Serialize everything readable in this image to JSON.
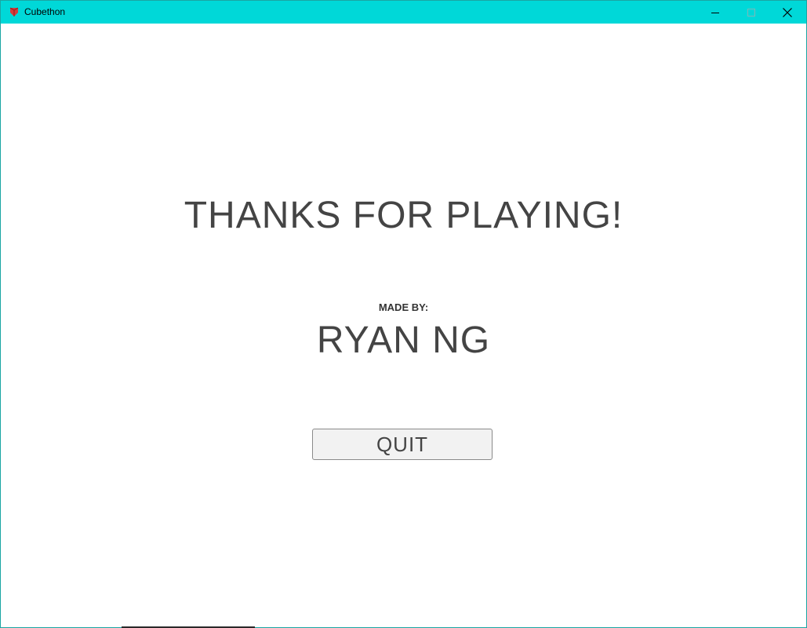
{
  "window": {
    "title": "Cubethon",
    "icon": "cubethon-app-icon",
    "titlebar_color": "#00d8d8",
    "controls": {
      "minimize_icon": "minimize-icon",
      "maximize_icon": "maximize-icon",
      "close_icon": "close-icon"
    }
  },
  "screen": {
    "heading": "THANKS FOR PLAYING!",
    "credits_label": "MADE BY:",
    "author": "RYAN NG",
    "quit_label": "QUIT"
  }
}
